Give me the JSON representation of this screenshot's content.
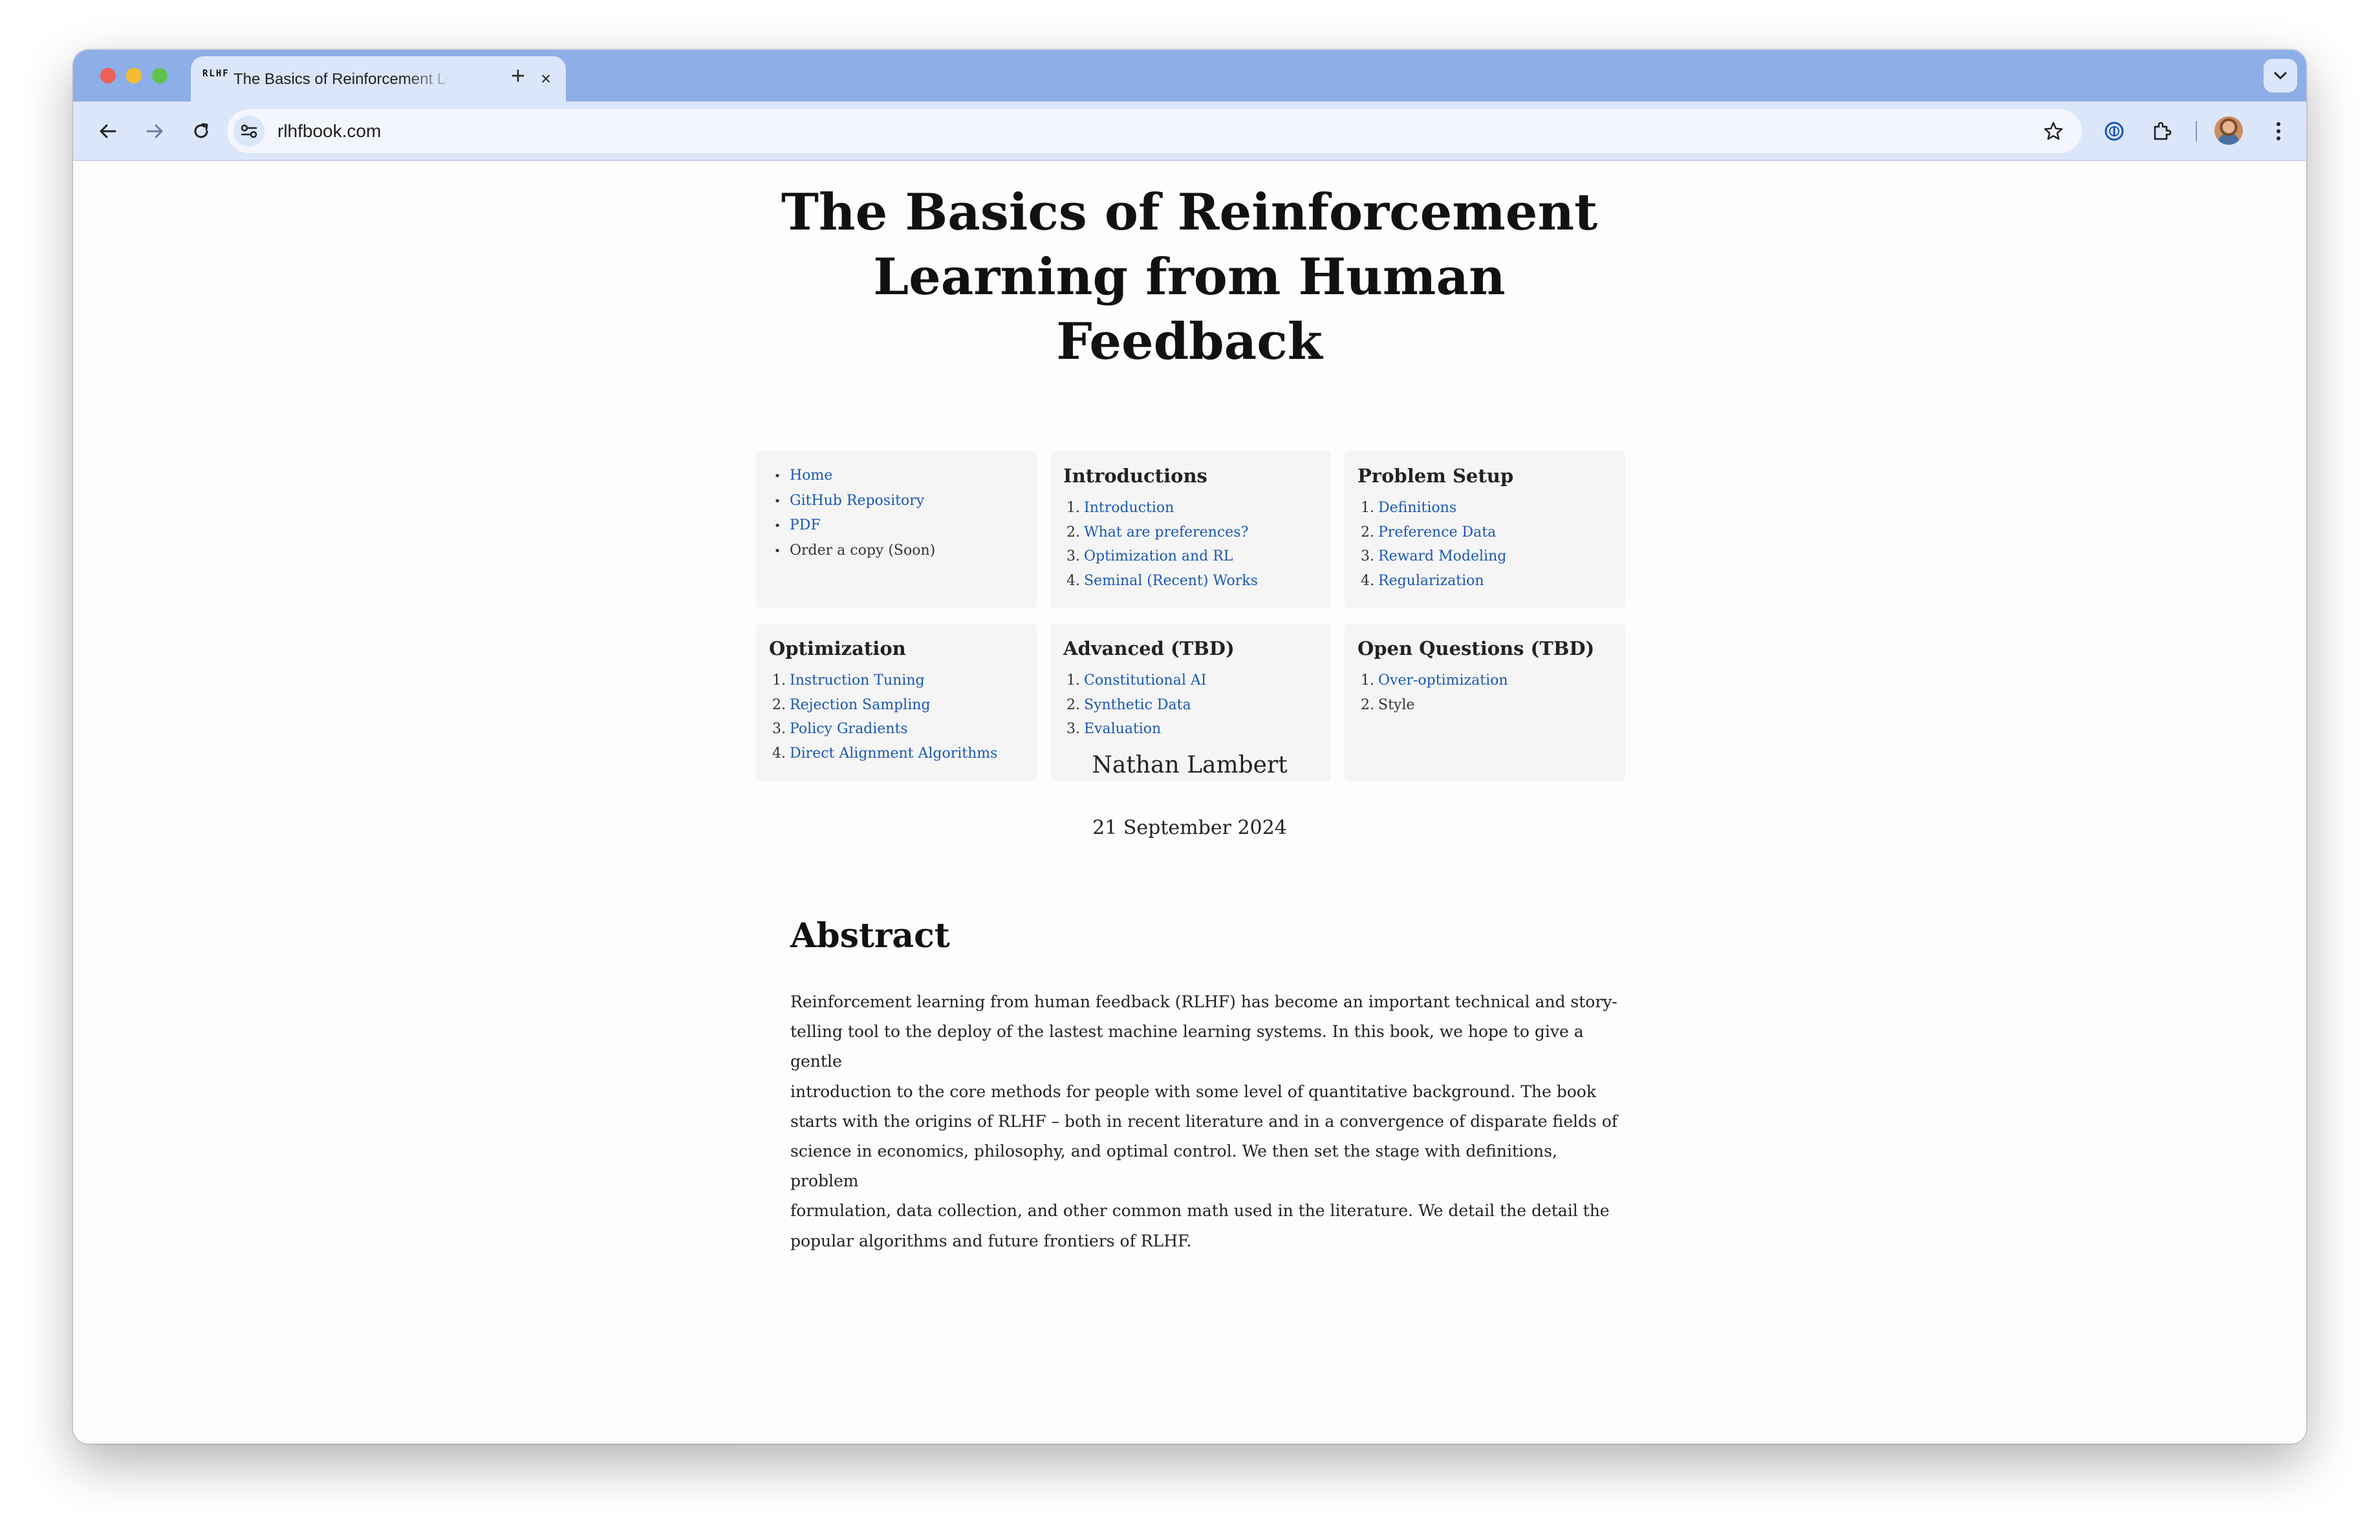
{
  "browser": {
    "tab_title": "The Basics of Reinforcement Learning from Human Feedback",
    "tab_close_glyph": "×",
    "new_tab_glyph": "+",
    "favicon_text": "RLHF",
    "url": "rlhfbook.com"
  },
  "page": {
    "title": "The Basics of Reinforcement Learning from Human Feedback",
    "links_card": {
      "items": [
        "Home",
        "GitHub Repository",
        "PDF",
        "Order a copy (Soon)"
      ]
    },
    "sections": [
      {
        "heading": "Introductions",
        "items": [
          "Introduction",
          "What are preferences?",
          "Optimization and RL",
          "Seminal (Recent) Works"
        ]
      },
      {
        "heading": "Problem Setup",
        "items": [
          "Definitions",
          "Preference Data",
          "Reward Modeling",
          "Regularization"
        ]
      },
      {
        "heading": "Optimization",
        "items": [
          "Instruction Tuning",
          "Rejection Sampling",
          "Policy Gradients",
          "Direct Alignment Algorithms"
        ]
      },
      {
        "heading": "Advanced (TBD)",
        "items": [
          "Constitutional AI",
          "Synthetic Data",
          "Evaluation"
        ]
      },
      {
        "heading": "Open Questions (TBD)",
        "items": [
          "Over-optimization",
          "Style"
        ]
      }
    ],
    "numbers": [
      "1.",
      "2.",
      "3.",
      "4."
    ],
    "author": "Nathan Lambert",
    "date": "21 September 2024",
    "abstract_heading": "Abstract",
    "abstract_lines": [
      "Reinforcement learning from human feedback (RLHF) has become an important technical and story-",
      "telling tool to the deploy of the lastest machine learning systems. In this book, we hope to give a gentle",
      "introduction to the core methods for people with some level of quantitative background. The book",
      "starts with the origins of RLHF – both in recent literature and in a convergence of disparate fields of",
      "science in economics, philosophy, and optimal control. We then set the stage with definitions, problem",
      "formulation, data collection, and other common math used in the literature. We detail the detail the",
      "popular algorithms and future frontiers of RLHF."
    ]
  },
  "colors": {
    "tabstrip": "#8eaee8",
    "toolbar": "#dbe6fb",
    "link": "#1a57b3",
    "card_bg": "#f5f5f5"
  }
}
